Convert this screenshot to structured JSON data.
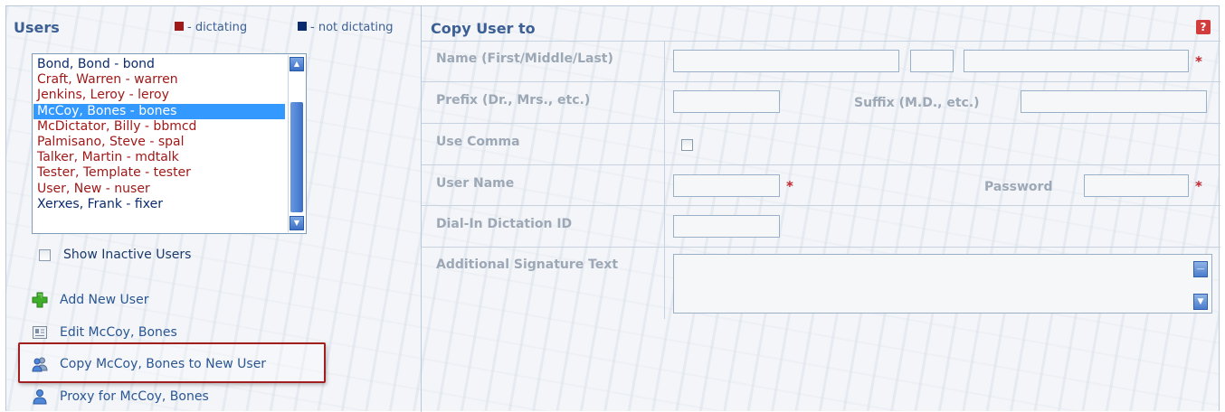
{
  "users_panel": {
    "title": "Users",
    "legend_dictating": "- dictating",
    "legend_not_dictating": "- not dictating",
    "colors": {
      "dictating": "#a01818",
      "not_dictating": "#0b2b6f"
    },
    "users": [
      {
        "label": "Bond, Bond - bond",
        "status": "not_dictating",
        "selected": false
      },
      {
        "label": "Craft, Warren - warren",
        "status": "dictating",
        "selected": false
      },
      {
        "label": "Jenkins, Leroy - leroy",
        "status": "dictating",
        "selected": false
      },
      {
        "label": "McCoy, Bones - bones",
        "status": "dictating",
        "selected": true
      },
      {
        "label": "McDictator, Billy - bbmcd",
        "status": "dictating",
        "selected": false
      },
      {
        "label": "Palmisano, Steve - spal",
        "status": "dictating",
        "selected": false
      },
      {
        "label": "Talker, Martin - mdtalk",
        "status": "dictating",
        "selected": false
      },
      {
        "label": "Tester, Template - tester",
        "status": "dictating",
        "selected": false
      },
      {
        "label": "User, New - nuser",
        "status": "dictating",
        "selected": false
      },
      {
        "label": "Xerxes, Frank - fixer",
        "status": "not_dictating",
        "selected": false
      }
    ],
    "show_inactive_label": "Show Inactive Users",
    "show_inactive_checked": false,
    "actions": {
      "add": "Add New User",
      "edit": "Edit McCoy, Bones",
      "copy": "Copy McCoy, Bones to New User",
      "proxy": "Proxy for McCoy, Bones"
    }
  },
  "copy_form": {
    "title": "Copy User to",
    "help_icon": "?",
    "fields": {
      "name_label": "Name (First/Middle/Last)",
      "prefix_label": "Prefix (Dr., Mrs., etc.)",
      "suffix_label": "Suffix (M.D., etc.)",
      "comma_label": "Use Comma",
      "username_label": "User Name",
      "password_label": "Password",
      "dialin_label": "Dial-In Dictation ID",
      "signature_label": "Additional Signature Text"
    },
    "required_mark": "*",
    "use_comma_checked": false
  }
}
